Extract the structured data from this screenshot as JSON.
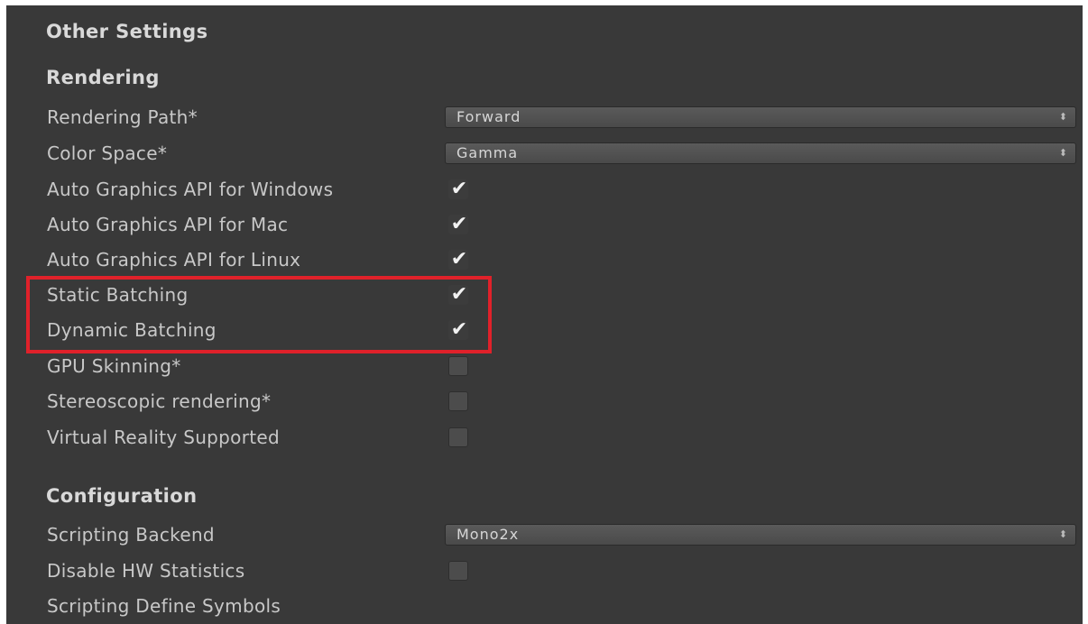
{
  "headings": {
    "other_settings": "Other Settings",
    "rendering": "Rendering",
    "configuration": "Configuration"
  },
  "rendering": {
    "rendering_path": {
      "label": "Rendering Path*",
      "value": "Forward"
    },
    "color_space": {
      "label": "Color Space*",
      "value": "Gamma"
    },
    "auto_graphics_windows": {
      "label": "Auto Graphics API for Windows",
      "checked": true
    },
    "auto_graphics_mac": {
      "label": "Auto Graphics API for Mac",
      "checked": true
    },
    "auto_graphics_linux": {
      "label": "Auto Graphics API for Linux",
      "checked": true
    },
    "static_batching": {
      "label": "Static Batching",
      "checked": true
    },
    "dynamic_batching": {
      "label": "Dynamic Batching",
      "checked": true
    },
    "gpu_skinning": {
      "label": "GPU Skinning*",
      "checked": false
    },
    "stereoscopic_rendering": {
      "label": "Stereoscopic rendering*",
      "checked": false
    },
    "virtual_reality_supported": {
      "label": "Virtual Reality Supported",
      "checked": false
    }
  },
  "configuration": {
    "scripting_backend": {
      "label": "Scripting Backend",
      "value": "Mono2x"
    },
    "disable_hw_statistics": {
      "label": "Disable HW Statistics",
      "checked": false
    },
    "scripting_define_symbols": {
      "label": "Scripting Define Symbols"
    }
  },
  "icons": {
    "check": "✔",
    "dropdown_arrow": "⬍"
  },
  "colors": {
    "panel_background": "#393939",
    "highlight_border": "#e0212a"
  }
}
